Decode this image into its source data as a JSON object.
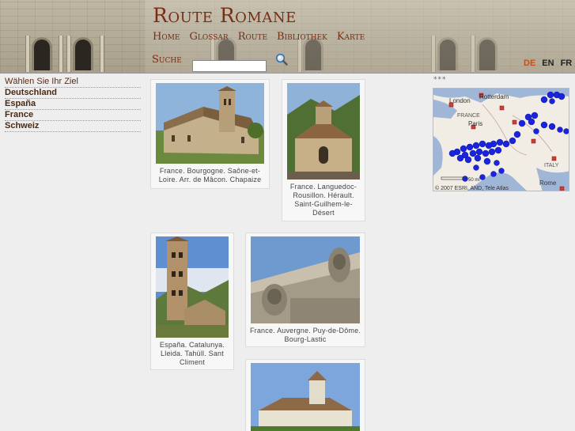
{
  "header": {
    "title": "Route Romane",
    "nav": [
      "Home",
      "Glossar",
      "Route",
      "Bibliothek",
      "Karte"
    ],
    "search_label": "Suche",
    "search_value": "",
    "languages": [
      "DE",
      "EN",
      "FR"
    ],
    "active_language": "DE"
  },
  "sidebar": {
    "heading": "Wählen Sie Ihr Ziel",
    "items": [
      "Deutschland",
      "España",
      "France",
      "Schweiz"
    ]
  },
  "cards": [
    {
      "caption": "France. Bourgogne. Saône-et-Loire. Arr. de Mâcon. Chapaize"
    },
    {
      "caption": "France. Languedoc-Rousillon. Hérault. Saint-Guilhem-le-Désert"
    },
    {
      "caption": "España. Catalunya. Lleida. Tahüll. Sant Climent"
    },
    {
      "caption": "France. Auvergne. Puy-de-Dôme. Bourg-Lastic"
    },
    {
      "caption": ""
    }
  ],
  "map": {
    "dots_label": "***",
    "labels": {
      "london": "London",
      "rotterdam": "Rotterdam",
      "france": "FRANCE",
      "paris": "Paris",
      "italy": "ITALY",
      "rome": "Rome"
    },
    "copyright": "© 2007 ESRI, AND, Tele Atlas",
    "scale": "50 mi"
  },
  "colors": {
    "brand": "#7a2d14",
    "active_lang": "#d24c12",
    "marker": "#1a24e0",
    "sea": "#9fb6d6",
    "land": "#f1ede4"
  }
}
